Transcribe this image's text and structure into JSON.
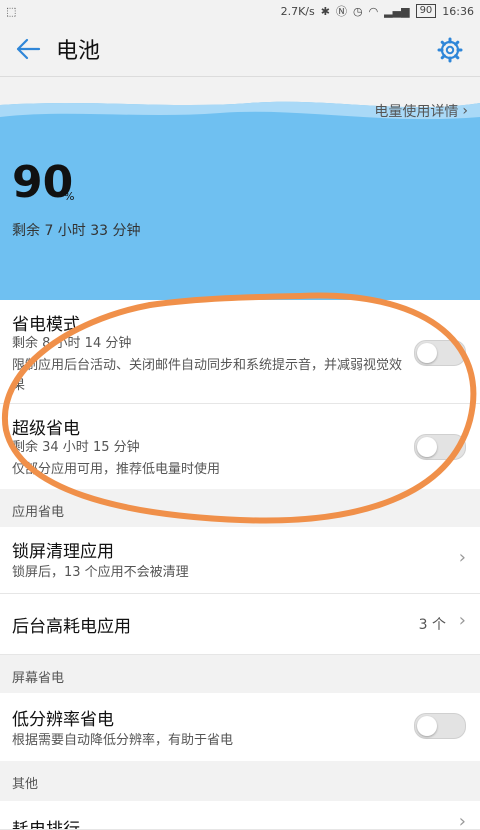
{
  "status": {
    "speed": "2.7K/s",
    "battery": "90",
    "time": "16:36"
  },
  "header": {
    "title": "电池"
  },
  "hero": {
    "usage_link": "电量使用详情",
    "percent": "90",
    "percent_sign": "%",
    "remaining": "剩余 7 小时 33 分钟"
  },
  "power_saving": {
    "title": "省电模式",
    "time": "剩余 8 小时 14 分钟",
    "desc": "限制应用后台活动、关闭邮件自动同步和系统提示音，并减弱视觉效果"
  },
  "ultra_saving": {
    "title": "超级省电",
    "time": "剩余 34 小时 15 分钟",
    "desc": "仅部分应用可用，推荐低电量时使用"
  },
  "section_app": "应用省电",
  "lock_clean": {
    "title": "锁屏清理应用",
    "desc": "锁屏后，13 个应用不会被清理"
  },
  "background": {
    "title": "后台高耗电应用",
    "count": "3 个"
  },
  "section_screen": "屏幕省电",
  "low_res": {
    "title": "低分辨率省电",
    "desc": "根据需要自动降低分辨率，有助于省电"
  },
  "section_other": "其他",
  "consumption": {
    "title": "耗电排行"
  },
  "colors": {
    "accent": "#2f86d8",
    "hero": "#6fc0f1",
    "annotation": "#f0904a"
  }
}
